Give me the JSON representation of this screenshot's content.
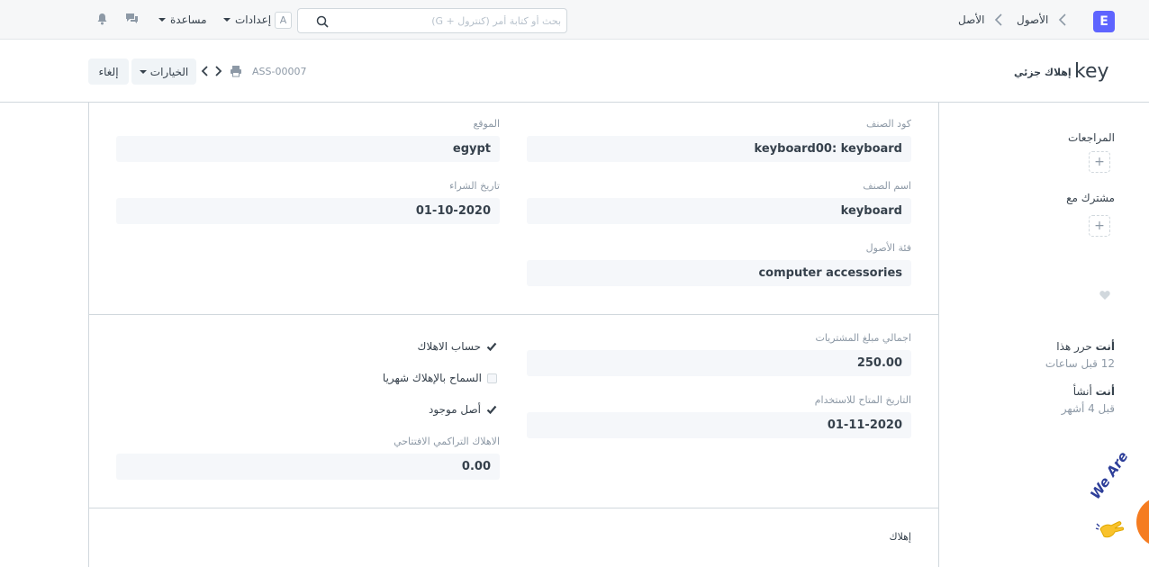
{
  "navbar": {
    "logo": "E",
    "breadcrumbs": [
      "الأصول",
      "الأصل"
    ],
    "search": {
      "placeholder": "بحث أو كتابة أمر (كنترول + G)"
    },
    "avatar_letter": "A",
    "settings_label": "إعدادات",
    "help_label": "مساعدة"
  },
  "page_head": {
    "title": "key",
    "status": "إهلاك جزئي",
    "doc_name": "ASS-00007",
    "options_label": "الخيارات",
    "cancel_label": "إلغاء"
  },
  "form": {
    "section1": {
      "item_code": {
        "label": "كود الصنف",
        "value": "keyboard00: keyboard"
      },
      "item_name": {
        "label": "اسم الصنف",
        "value": "keyboard"
      },
      "asset_category": {
        "label": "فئة الأصول",
        "value": "computer accessories"
      },
      "location": {
        "label": "الموقع",
        "value": "egypt"
      },
      "purchase_date": {
        "label": "تاريخ الشراء",
        "value": "01-10-2020"
      }
    },
    "section2": {
      "gross_purchase_amount": {
        "label": "اجمالي مبلغ المشتريات",
        "value": "250.00"
      },
      "available_for_use_date": {
        "label": "التاريخ المتاح للاستخدام",
        "value": "01-11-2020"
      },
      "calculate_depreciation": {
        "label": "حساب الاهلاك",
        "checked": true
      },
      "allow_monthly_depreciation": {
        "label": "السماح بالإهلاك شهريا",
        "checked": false
      },
      "is_existing_asset": {
        "label": "أصل موجود",
        "checked": true
      },
      "opening_accumulated_depreciation": {
        "label": "الاهلاك التراكمي الافتتاحي",
        "value": "0.00"
      }
    },
    "section3": {
      "heading": "إهلاك"
    }
  },
  "sidebar": {
    "reviews_label": "المراجعات",
    "shared_with_label": "مشترك مع",
    "timeline": [
      {
        "actor": "أنت",
        "action": "حرر هذا",
        "time": "12 قبل ساعات"
      },
      {
        "actor": "أنت",
        "action": "أنشأ",
        "time": "قبل 4 أشهر"
      }
    ]
  },
  "chat_widget": {
    "text": "We Are"
  },
  "colors": {
    "brand": "#5e64ff",
    "navbar_bg": "#f6f7f8",
    "field_bg": "#f5f7fa",
    "text": "#36414c",
    "muted": "#8d99a6",
    "chat": "#f57c21"
  }
}
